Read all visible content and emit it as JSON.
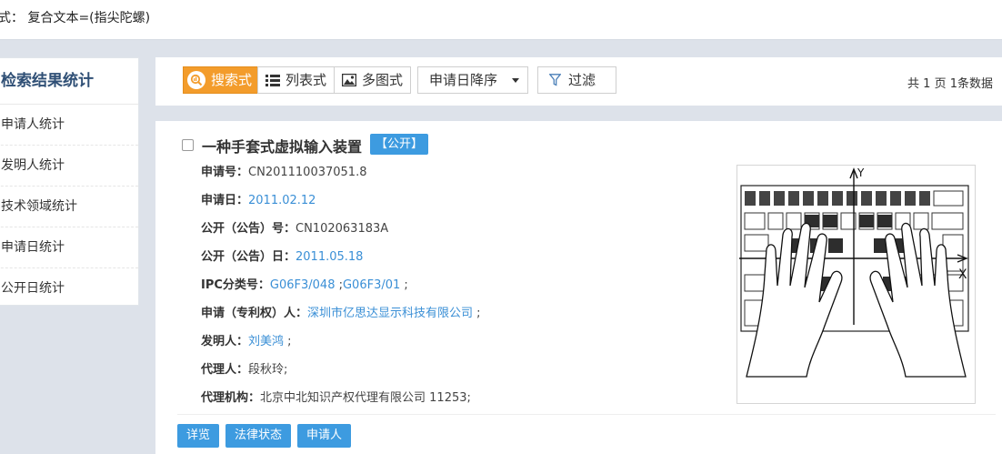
{
  "query": {
    "text": "式： 复合文本=(指尖陀螺)"
  },
  "sidebar": {
    "title": "检索结果统计",
    "items": [
      {
        "label": "申请人统计"
      },
      {
        "label": "发明人统计"
      },
      {
        "label": "技术领域统计"
      },
      {
        "label": "申请日统计"
      },
      {
        "label": "公开日统计"
      }
    ]
  },
  "toolbar": {
    "views": [
      {
        "label": "搜索式",
        "icon": "search-style-icon",
        "active": true
      },
      {
        "label": "列表式",
        "icon": "list-icon",
        "active": false
      },
      {
        "label": "多图式",
        "icon": "image-icon",
        "active": false
      }
    ],
    "sort": {
      "selected": "申请日降序"
    },
    "filter_label": "过滤",
    "page_info": "共 1 页 1条数据",
    "accent_color": "#f39c2b"
  },
  "result": {
    "title": "一种手套式虚拟输入装置",
    "status_badge": "【公开】",
    "fields": {
      "app_no": {
        "key": "申请号：",
        "value": "CN201110037051.8"
      },
      "app_date": {
        "key": "申请日：",
        "value": "2011.02.12"
      },
      "pub_no": {
        "key": "公开（公告）号：",
        "value": "CN102063183A"
      },
      "pub_date": {
        "key": "公开（公告）日：",
        "value": "2011.05.18"
      },
      "ipc": {
        "key": "IPC分类号：",
        "link1": "G06F3/048",
        "sep1": " ;",
        "link2": "G06F3/01",
        "tail": " ;"
      },
      "applicant": {
        "key": "申请（专利权）人：",
        "link": "深圳市亿思达显示科技有限公司",
        "tail": " ;"
      },
      "inventor": {
        "key": "发明人：",
        "link": "刘美鸿",
        "tail": " ;"
      },
      "agent": {
        "key": "代理人：",
        "value": "段秋玲;"
      },
      "agency": {
        "key": "代理机构：",
        "value": "北京中北知识产权代理有限公司 11253;"
      }
    },
    "figure_labels": {
      "y_axis": "Y",
      "x_axis": "X"
    },
    "actions": {
      "detail": "详览",
      "legal": "法律状态",
      "applicant": "申请人"
    },
    "link_color": "#3a8fd6",
    "badge_color": "#3d9be0"
  }
}
